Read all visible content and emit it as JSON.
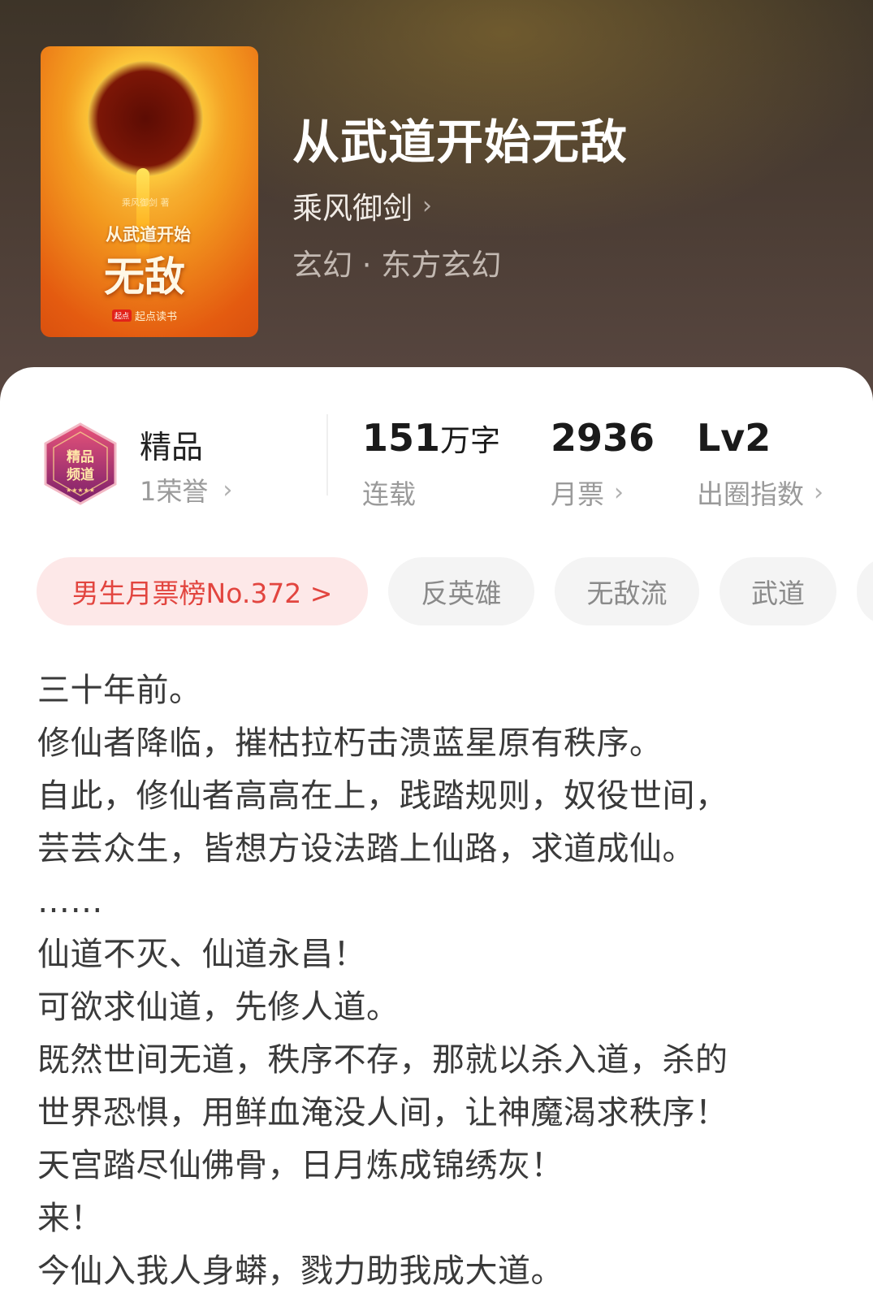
{
  "book": {
    "title": "从武道开始无敌",
    "author": "乘风御剑",
    "genre": "玄幻 · 东方玄幻",
    "cover": {
      "author_line": "乘风御剑 著",
      "title_line1": "从武道开始",
      "title_line2": "无敌",
      "publisher": "起点读书",
      "publisher_mark": "起点"
    }
  },
  "honor": {
    "badge_text": "精品频道",
    "name": "精品",
    "count": "1荣誉"
  },
  "stats": [
    {
      "value": "151",
      "unit": "万字",
      "label": "连载"
    },
    {
      "value": "2936",
      "unit": "",
      "label": "月票"
    },
    {
      "value": "Lv2",
      "unit": "",
      "label": "出圈指数"
    }
  ],
  "tags": [
    {
      "label": "男生月票榜No.372 >"
    },
    {
      "label": "反英雄"
    },
    {
      "label": "无敌流"
    },
    {
      "label": "武道"
    }
  ],
  "synopsis": [
    "三十年前。",
    "修仙者降临，摧枯拉朽击溃蓝星原有秩序。",
    "自此，修仙者高高在上，践踏规则，奴役世间，",
    "芸芸众生，皆想方设法踏上仙路，求道成仙。",
    "……",
    "仙道不灭、仙道永昌！",
    "可欲求仙道，先修人道。",
    "既然世间无道，秩序不存，那就以杀入道，杀的",
    "世界恐惧，用鲜血淹没人间，让神魔渴求秩序！",
    "天宫踏尽仙佛骨，日月炼成锦绣灰！",
    "来！",
    "今仙入我人身蟒，戮力助我成大道。"
  ],
  "colors": {
    "rank_tag_text": "#e2453f",
    "rank_tag_bg": "#fde8e8",
    "hero_bg": "#4a3c33"
  }
}
